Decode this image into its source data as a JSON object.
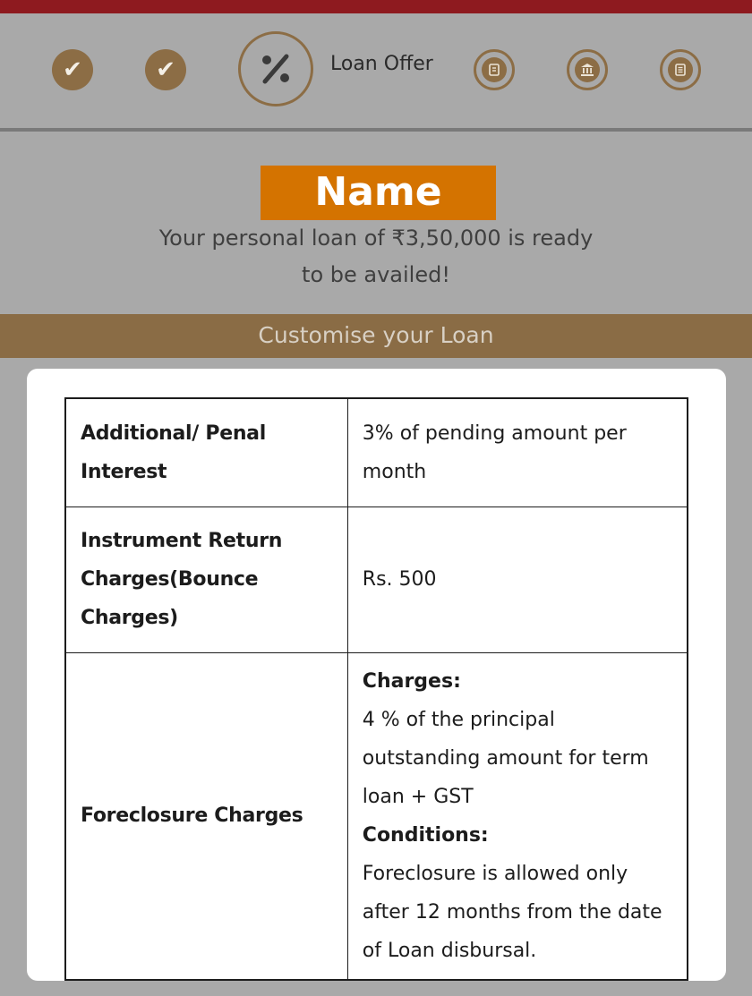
{
  "stepper": {
    "current_label": "Loan Offer"
  },
  "banner": {
    "name": "Name",
    "offer_line1": "Your personal loan of ₹3,50,000 is ready",
    "offer_line2": "to be availed!"
  },
  "section": {
    "title": "Customise your Loan"
  },
  "charges": {
    "rows": [
      {
        "label": "Additional/ Penal Interest",
        "value": "3% of pending amount per month"
      },
      {
        "label": "Instrument Return Charges(Bounce Charges)",
        "value": "Rs. 500"
      },
      {
        "label": "Foreclosure Charges",
        "charges_heading": "Charges:",
        "charges_text": "4 % of the principal outstanding amount for term loan + GST",
        "conditions_heading": "Conditions:",
        "conditions_text": "Foreclosure is allowed only after 12 months from the date of Loan disbursal."
      }
    ]
  },
  "colors": {
    "top_bar": "#8e1a1f",
    "accent": "#8c6d45",
    "name_banner": "#d47300",
    "background": "#a9a9a9"
  },
  "icons": [
    "check-icon",
    "check-icon",
    "percent-icon",
    "document-icon",
    "bank-icon",
    "list-icon"
  ]
}
